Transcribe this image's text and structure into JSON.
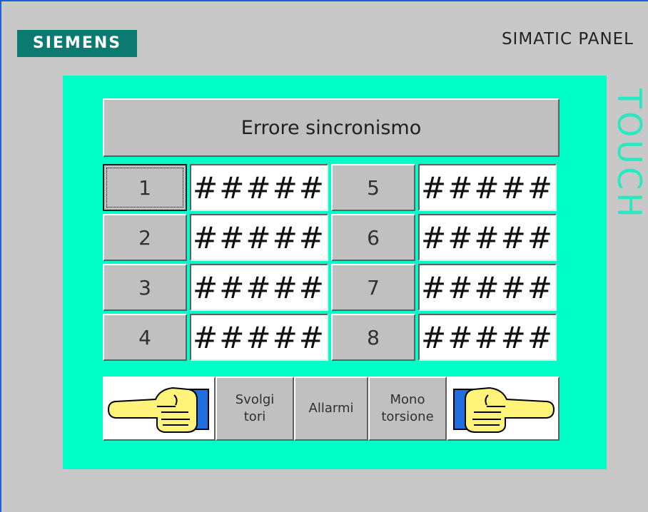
{
  "brand": {
    "logo": "SIEMENS",
    "model": "SIMATIC PANEL",
    "side": "TOUCH"
  },
  "screen": {
    "title_button": "Errore sincronismo",
    "rows": [
      {
        "left_label": "1",
        "left_value": "#####",
        "right_label": "5",
        "right_value": "#####"
      },
      {
        "left_label": "2",
        "left_value": "#####",
        "right_label": "6",
        "right_value": "#####"
      },
      {
        "left_label": "3",
        "left_value": "#####",
        "right_label": "7",
        "right_value": "#####"
      },
      {
        "left_label": "4",
        "left_value": "#####",
        "right_label": "8",
        "right_value": "#####"
      }
    ],
    "nav": {
      "svolgitori_line1": "Svolgi",
      "svolgitori_line2": "tori",
      "allarmi": "Allarmi",
      "mono_line1": "Mono",
      "mono_line2": "torsione"
    }
  },
  "colors": {
    "panel_bg": "#c8c8c8",
    "screen_bg": "#00ffc8",
    "logo_bg": "#0b7a70",
    "touch_text": "#2ce8c0"
  }
}
